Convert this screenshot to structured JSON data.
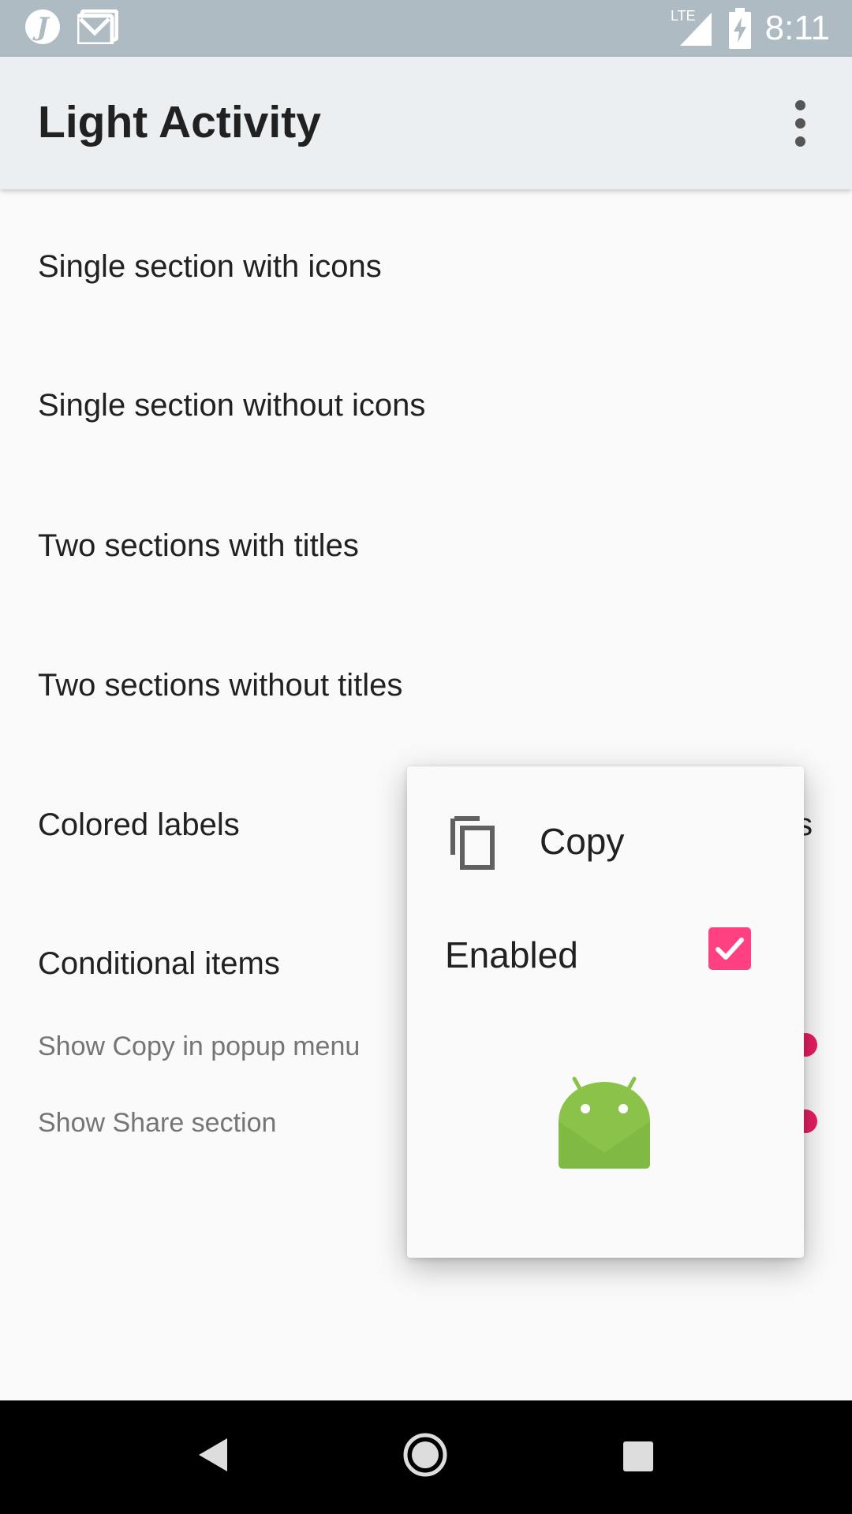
{
  "status_bar": {
    "time": "8:11",
    "network": "LTE",
    "icons": [
      "j-app-icon",
      "mail-icon",
      "lte-signal-icon",
      "battery-charging-icon"
    ]
  },
  "app_bar": {
    "title": "Light Activity",
    "overflow_icon": "more-vert-icon"
  },
  "list": {
    "items": [
      {
        "label": "Single section with icons"
      },
      {
        "label": "Single section without icons"
      },
      {
        "label": "Two sections with titles"
      },
      {
        "label": "Two sections without titles"
      },
      {
        "label": "Colored labels"
      },
      {
        "label": "Conditional items"
      }
    ],
    "sub_items": [
      {
        "label": "Show Copy in popup menu"
      },
      {
        "label": "Show Share section"
      }
    ],
    "partial_text": "s"
  },
  "popup": {
    "copy_label": "Copy",
    "copy_icon": "content-copy-icon",
    "enabled_label": "Enabled",
    "enabled_checked": true,
    "image_icon": "android-icon"
  },
  "nav_bar": {
    "icons": [
      "back-icon",
      "home-icon",
      "recents-icon"
    ]
  },
  "colors": {
    "status_bar": "#aebbc3",
    "app_bar": "#eceff1",
    "accent": "#ff4081",
    "android_green": "#8bc34a"
  }
}
